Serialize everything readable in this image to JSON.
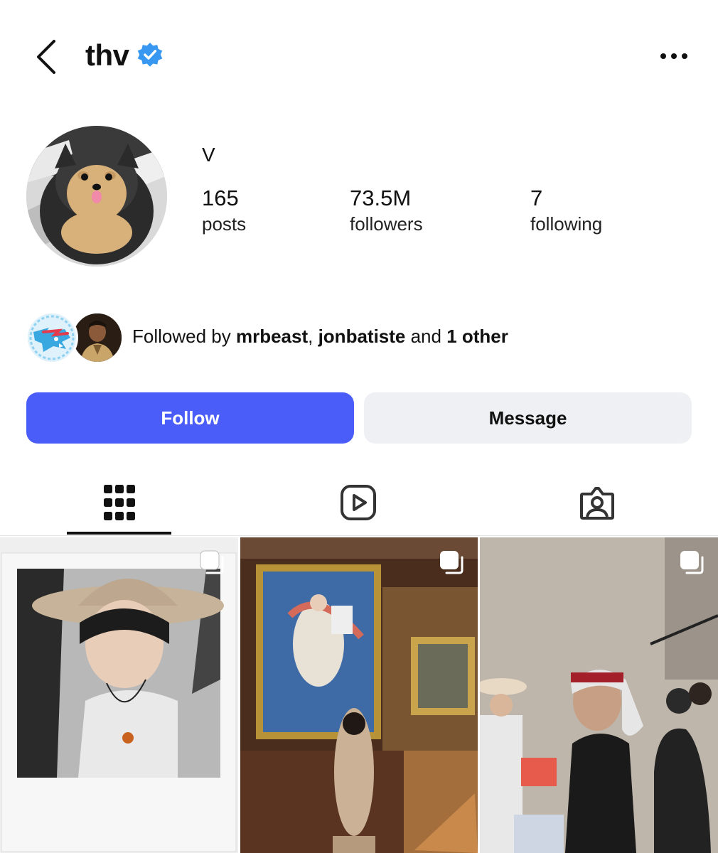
{
  "header": {
    "username": "thv"
  },
  "profile": {
    "display_name": "V",
    "stats": {
      "posts": {
        "value": "165",
        "label": "posts"
      },
      "followers": {
        "value": "73.5M",
        "label": "followers"
      },
      "following": {
        "value": "7",
        "label": "following"
      }
    }
  },
  "followed_by": {
    "prefix": "Followed by ",
    "user1": "mrbeast",
    "separator": ", ",
    "user2": "jonbatiste",
    "conjunction": " and ",
    "others": "1 other"
  },
  "actions": {
    "follow_label": "Follow",
    "message_label": "Message"
  },
  "tabs": [
    {
      "name": "posts-grid",
      "icon": "grid-icon",
      "active": true
    },
    {
      "name": "reels",
      "icon": "reels-icon",
      "active": false
    },
    {
      "name": "tagged",
      "icon": "tagged-icon",
      "active": false
    }
  ],
  "colors": {
    "accent": "#4a5df9",
    "verified": "#3897f0",
    "secondary_button": "#eff0f3"
  }
}
